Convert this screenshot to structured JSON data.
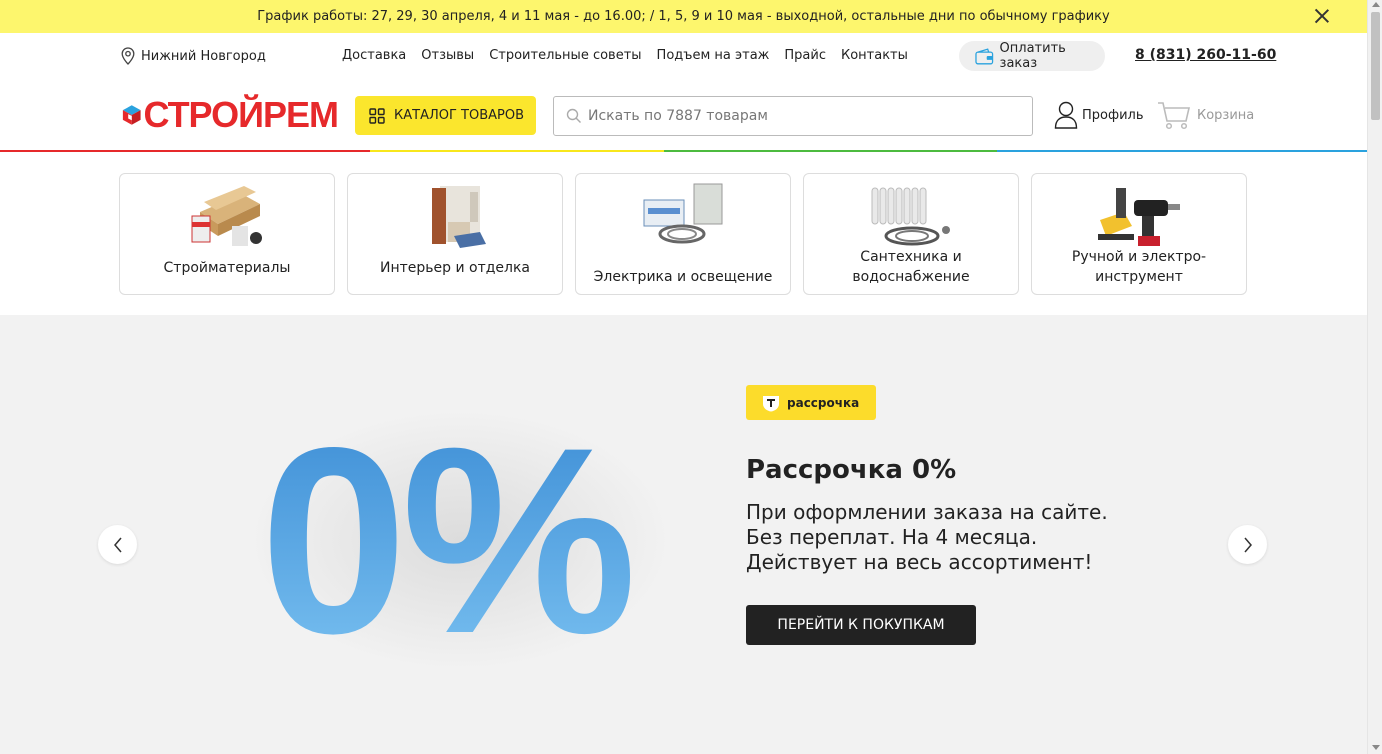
{
  "banner": {
    "text": "График работы: 27, 29, 30 апреля, 4 и 11 мая - до 16.00; / 1, 5, 9 и 10 мая - выходной, остальные дни по обычному графику"
  },
  "topnav": {
    "city": "Нижний Новгород",
    "links": [
      "Доставка",
      "Отзывы",
      "Строительные советы",
      "Подъем на этаж",
      "Прайс",
      "Контакты"
    ],
    "pay_label": "Оплатить заказ",
    "phone": "8 (831) 260-11-60"
  },
  "header": {
    "logo_text": "СТРОЙРЕМ",
    "catalog_label": "КАТАЛОГ ТОВАРОВ",
    "search_placeholder": "Искать по 7887 товарам",
    "profile_label": "Профиль",
    "cart_label": "Корзина"
  },
  "colors": {
    "banner": "#fdf66d",
    "accent_yellow": "#fbe62d",
    "logo_red": "#e6292b",
    "line": [
      "#e6292b",
      "#f8e71c",
      "#4cbb3f",
      "#2aa2de"
    ]
  },
  "categories": [
    {
      "label": "Стройматериалы",
      "icon": "building-materials-icon"
    },
    {
      "label": "Интерьер и отделка",
      "icon": "door-icon"
    },
    {
      "label": "Электрика и освещение",
      "icon": "electrical-panel-icon"
    },
    {
      "label": "Сантехника и водоснабжение",
      "icon": "radiator-icon"
    },
    {
      "label": "Ручной и электро-инструмент",
      "icon": "power-tools-icon"
    }
  ],
  "hero": {
    "big_text": "0%",
    "badge_label": "рассрочка",
    "title": "Рассрочка 0%",
    "lines": [
      "При оформлении заказа на сайте.",
      "Без переплат. На 4 месяца.",
      "Действует на весь ассортимент!"
    ],
    "button_label": "ПЕРЕЙТИ К ПОКУПКАМ"
  }
}
